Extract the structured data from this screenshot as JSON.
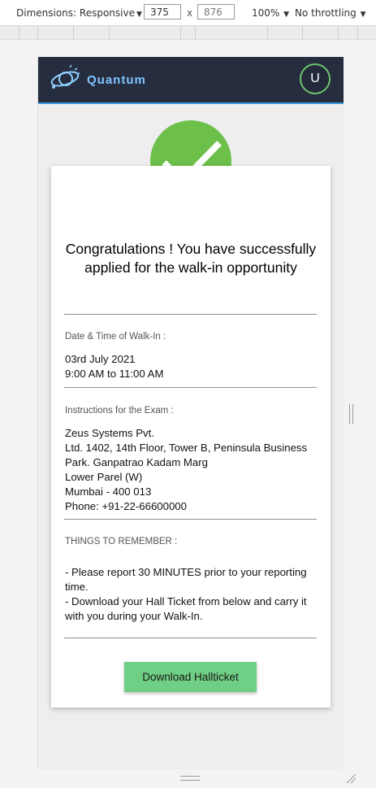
{
  "devtools": {
    "dimensions_label": "Dimensions: Responsive",
    "width": "375",
    "times": "x",
    "height": "876",
    "zoom": "100%",
    "throttling": "No throttling"
  },
  "app": {
    "brand": "Quantum",
    "avatar_initial": "U",
    "brand_color": "#7fc6ff",
    "header_color": "#262d3f"
  },
  "confirmation": {
    "heading": "Congratulations ! You have successfully applied for the walk-in opportunity",
    "success_color": "#6cc04a",
    "sections": [
      {
        "label": "Date & Time of Walk-In :",
        "value": "03rd July 2021\n9:00 AM to 11:00 AM"
      },
      {
        "label": "Instructions for the Exam :",
        "value": "Zeus Systems Pvt.\nLtd. 1402, 14th Floor, Tower B, Peninsula Business Park. Ganpatrao Kadam Marg\nLower Parel (W)\nMumbai - 400 013\nPhone: +91-22-66600000"
      },
      {
        "label": "THINGS TO REMEMBER :",
        "value": "- Please report 30 MINUTES prior to your reporting time.\n- Download your Hall Ticket from below and carry it with you during your Walk-In."
      }
    ],
    "download_label": "Download Hallticket",
    "button_color": "#6fcf84"
  }
}
